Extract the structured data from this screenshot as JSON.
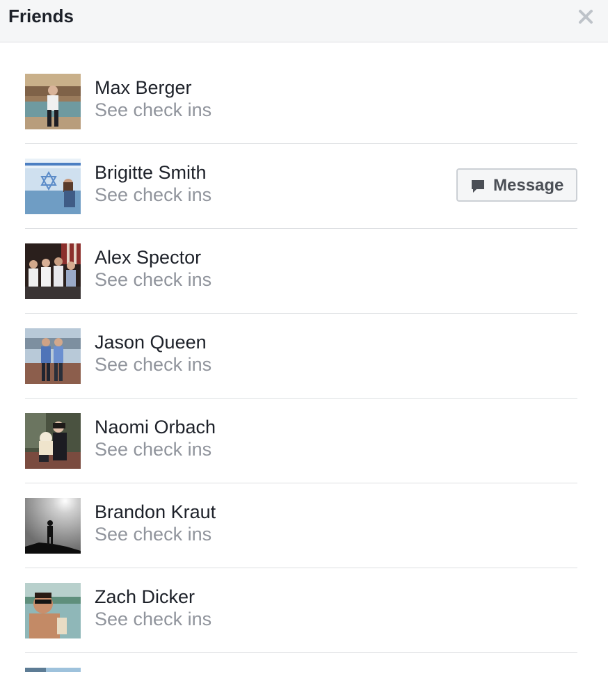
{
  "header": {
    "title": "Friends",
    "close_icon": "close-icon"
  },
  "friends": [
    {
      "name": "Max Berger",
      "subtitle": "See check ins",
      "avatar": "photo-man-fountain"
    },
    {
      "name": "Brigitte Smith",
      "subtitle": "See check ins",
      "avatar": "photo-woman-flag",
      "action_label": "Message",
      "action_icon": "message-bubble-icon"
    },
    {
      "name": "Alex Spector",
      "subtitle": "See check ins",
      "avatar": "photo-group-men"
    },
    {
      "name": "Jason Queen",
      "subtitle": "See check ins",
      "avatar": "photo-two-men"
    },
    {
      "name": "Naomi Orbach",
      "subtitle": "See check ins",
      "avatar": "photo-woman-dog"
    },
    {
      "name": "Brandon Kraut",
      "subtitle": "See check ins",
      "avatar": "photo-silhouette"
    },
    {
      "name": "Zach Dicker",
      "subtitle": "See check ins",
      "avatar": "photo-man-sunglasses"
    }
  ],
  "colors": {
    "name_text": "#1d2129",
    "subtitle_text": "#90949c",
    "header_bg": "#f5f6f7",
    "divider": "#dddfe2",
    "button_text": "#4b4f56"
  }
}
